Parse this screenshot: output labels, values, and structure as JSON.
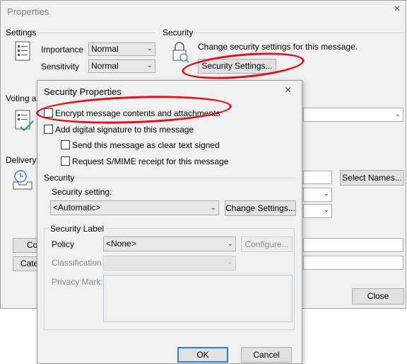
{
  "window": {
    "title": "Properties",
    "close_glyph": "×"
  },
  "settings": {
    "group_label": "Settings",
    "importance_label": "Importance",
    "importance_value": "Normal",
    "sensitivity_label": "Sensitivity",
    "sensitivity_value": "Normal"
  },
  "security_group": {
    "label": "Security",
    "description": "Change security settings for this message.",
    "button": "Security Settings..."
  },
  "voting": {
    "label_partial": "Voting ar"
  },
  "delivery": {
    "label_partial": "Delivery o",
    "select_names": "Select Names...",
    "close": "Close"
  },
  "left_buttons": {
    "contacts_partial": "Con",
    "categories_partial": "Categ"
  },
  "dialog": {
    "title": "Security Properties",
    "close_glyph": "×",
    "encrypt_label": "Encrypt message contents and attachments",
    "signature_label": "Add digital signature to this message",
    "clear_text_label": "Send this message as clear text signed",
    "smime_label": "Request S/MIME receipt for this message",
    "security_section": "Security",
    "security_setting_label": "Security setting:",
    "security_setting_value": "<Automatic>",
    "change_settings": "Change Settings...",
    "label_section": "Security Label",
    "policy_label": "Policy",
    "policy_value": "<None>",
    "configure": "Configure...",
    "classification_label": "Classification",
    "privacy_mark_label": "Privacy Mark:",
    "ok": "OK",
    "cancel": "Cancel"
  },
  "colors": {
    "annotation": "#e0101a",
    "dialog_bg": "#f0f0f0"
  }
}
